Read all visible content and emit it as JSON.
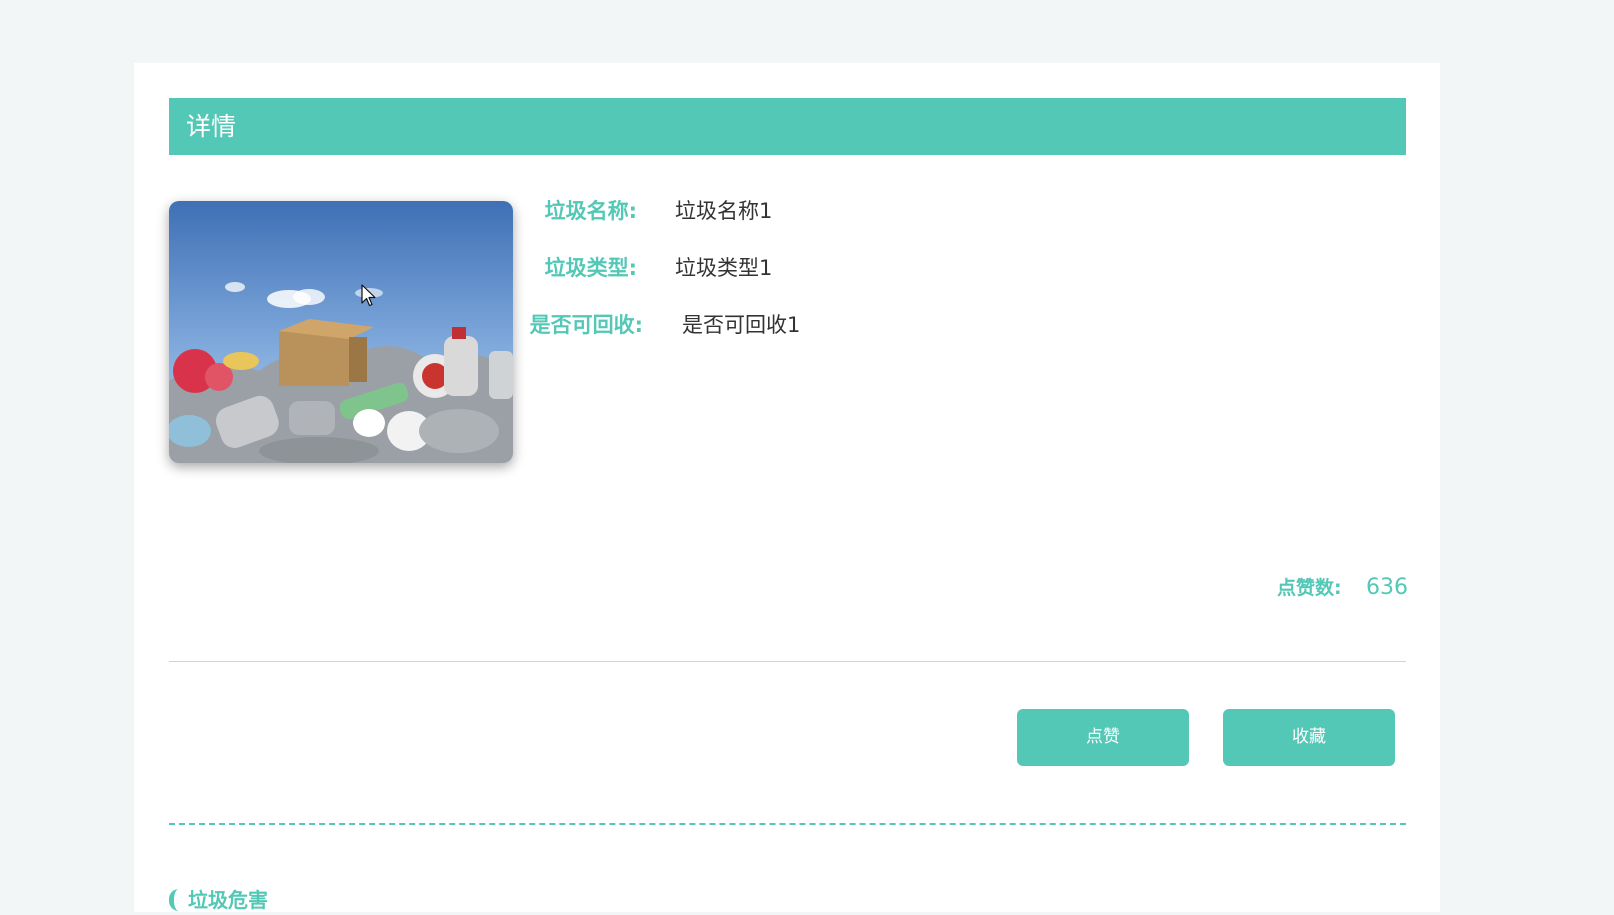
{
  "header": {
    "title": "详情"
  },
  "photo": {
    "icon": "garbage-pile-image"
  },
  "fields": [
    {
      "label": "垃圾名称:",
      "value": "垃圾名称1"
    },
    {
      "label": "垃圾类型:",
      "value": "垃圾类型1"
    },
    {
      "label": "是否可回收:",
      "value": "是否可回收1"
    }
  ],
  "likes": {
    "label": "点赞数:",
    "value": "636"
  },
  "actions": {
    "like_label": "点赞",
    "favorite_label": "收藏"
  },
  "section": {
    "title": "垃圾危害"
  },
  "colors": {
    "accent": "#54c8b6",
    "background": "#f3f6f6",
    "card": "#ffffff"
  }
}
